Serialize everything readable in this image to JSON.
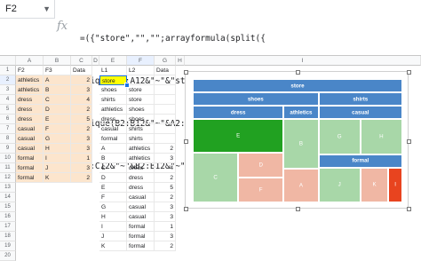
{
  "formula_bar": {
    "name_box": "F2",
    "fx_icon": "fx",
    "lines": [
      "=({\"store\",\"\",\"\";arrayformula(split({",
      "unique(A2:A12&\"~\"&\"store\");",
      "unique(B2:B12&\"~\"&A2:A12);",
      "C2:C12&\"~\"&B2:B12&\"~\"&D2:D12 },\"~\"))})"
    ]
  },
  "columns": [
    "A",
    "B",
    "C",
    "D",
    "E",
    "F",
    "G",
    "H",
    "I"
  ],
  "rows": [
    "1",
    "2",
    "3",
    "4",
    "5",
    "6",
    "7",
    "8",
    "9",
    "10",
    "11",
    "12",
    "13",
    "14",
    "15",
    "16",
    "17",
    "18",
    "19",
    "20"
  ],
  "left_table": {
    "headers": [
      "F2",
      "F3",
      "Data"
    ],
    "rows": [
      [
        "athletics",
        "A",
        "2"
      ],
      [
        "athletics",
        "B",
        "3"
      ],
      [
        "dress",
        "C",
        "4"
      ],
      [
        "dress",
        "D",
        "2"
      ],
      [
        "dress",
        "E",
        "5"
      ],
      [
        "casual",
        "F",
        "2"
      ],
      [
        "casual",
        "G",
        "3"
      ],
      [
        "casual",
        "H",
        "3"
      ],
      [
        "formal",
        "I",
        "1"
      ],
      [
        "formal",
        "J",
        "3"
      ],
      [
        "formal",
        "K",
        "2"
      ]
    ]
  },
  "right_table": {
    "headers": [
      "L1",
      "L2",
      "Data"
    ],
    "rows": [
      [
        "store",
        "",
        ""
      ],
      [
        "shoes",
        "store",
        ""
      ],
      [
        "shirts",
        "store",
        ""
      ],
      [
        "athletics",
        "shoes",
        ""
      ],
      [
        "dress",
        "shoes",
        ""
      ],
      [
        "casual",
        "shirts",
        ""
      ],
      [
        "formal",
        "shirts",
        ""
      ],
      [
        "A",
        "athletics",
        "2"
      ],
      [
        "B",
        "athletics",
        "3"
      ],
      [
        "C",
        "dress",
        "4"
      ],
      [
        "D",
        "dress",
        "2"
      ],
      [
        "E",
        "dress",
        "5"
      ],
      [
        "F",
        "casual",
        "2"
      ],
      [
        "G",
        "casual",
        "3"
      ],
      [
        "H",
        "casual",
        "3"
      ],
      [
        "I",
        "formal",
        "1"
      ],
      [
        "J",
        "formal",
        "3"
      ],
      [
        "K",
        "formal",
        "2"
      ]
    ]
  },
  "chart_data": {
    "type": "treemap",
    "root": "store",
    "groups": [
      {
        "name": "shoes",
        "children": [
          {
            "name": "dress",
            "leaves": [
              {
                "name": "E",
                "value": 5
              },
              {
                "name": "C",
                "value": 4
              },
              {
                "name": "D",
                "value": 2
              },
              {
                "name": "F",
                "value": 2
              }
            ]
          },
          {
            "name": "athletics",
            "leaves": [
              {
                "name": "B",
                "value": 3
              },
              {
                "name": "A",
                "value": 2
              }
            ]
          }
        ]
      },
      {
        "name": "shirts",
        "children": [
          {
            "name": "casual",
            "leaves": [
              {
                "name": "G",
                "value": 3
              },
              {
                "name": "H",
                "value": 3
              }
            ]
          },
          {
            "name": "formal",
            "leaves": [
              {
                "name": "J",
                "value": 3
              },
              {
                "name": "K",
                "value": 2
              },
              {
                "name": "I",
                "value": 1
              }
            ]
          }
        ]
      }
    ],
    "colors": {
      "header": "#4a86c8",
      "high": "#21a121",
      "mid": "#a8d7a8",
      "low_light": "#f0b7a4",
      "low": "#e8441f"
    }
  }
}
